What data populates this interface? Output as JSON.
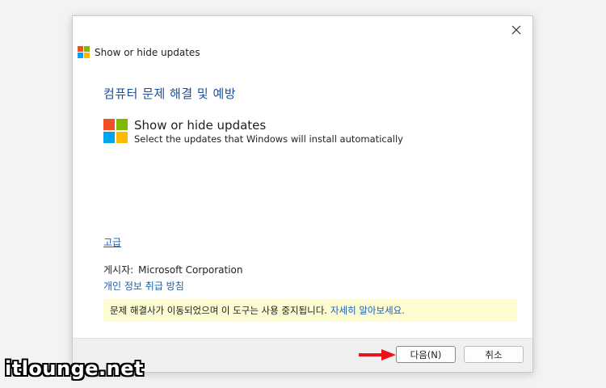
{
  "window": {
    "title": "Show or hide updates",
    "close_icon": "close-icon"
  },
  "main": {
    "heading": "컴퓨터 문제 해결 및 예방",
    "product_title": "Show or hide updates",
    "product_subtitle": "Select the updates that Windows will install automatically",
    "advanced_link": "고급",
    "publisher_label": "게시자:",
    "publisher_value": "Microsoft Corporation",
    "privacy_link": "개인 정보 취급 방침",
    "notice_text": "문제 해결사가 이동되었으며 이 도구는 사용 중지됩니다.",
    "notice_link": "자세히 알아보세요."
  },
  "footer": {
    "next_label": "다음(N)",
    "cancel_label": "취소"
  },
  "watermark": "itlounge.net",
  "colors": {
    "accent_blue": "#1a4f9c",
    "link_blue": "#1a5fb4",
    "notice_bg": "#fcfbd2",
    "arrow_red": "#e8141b"
  }
}
